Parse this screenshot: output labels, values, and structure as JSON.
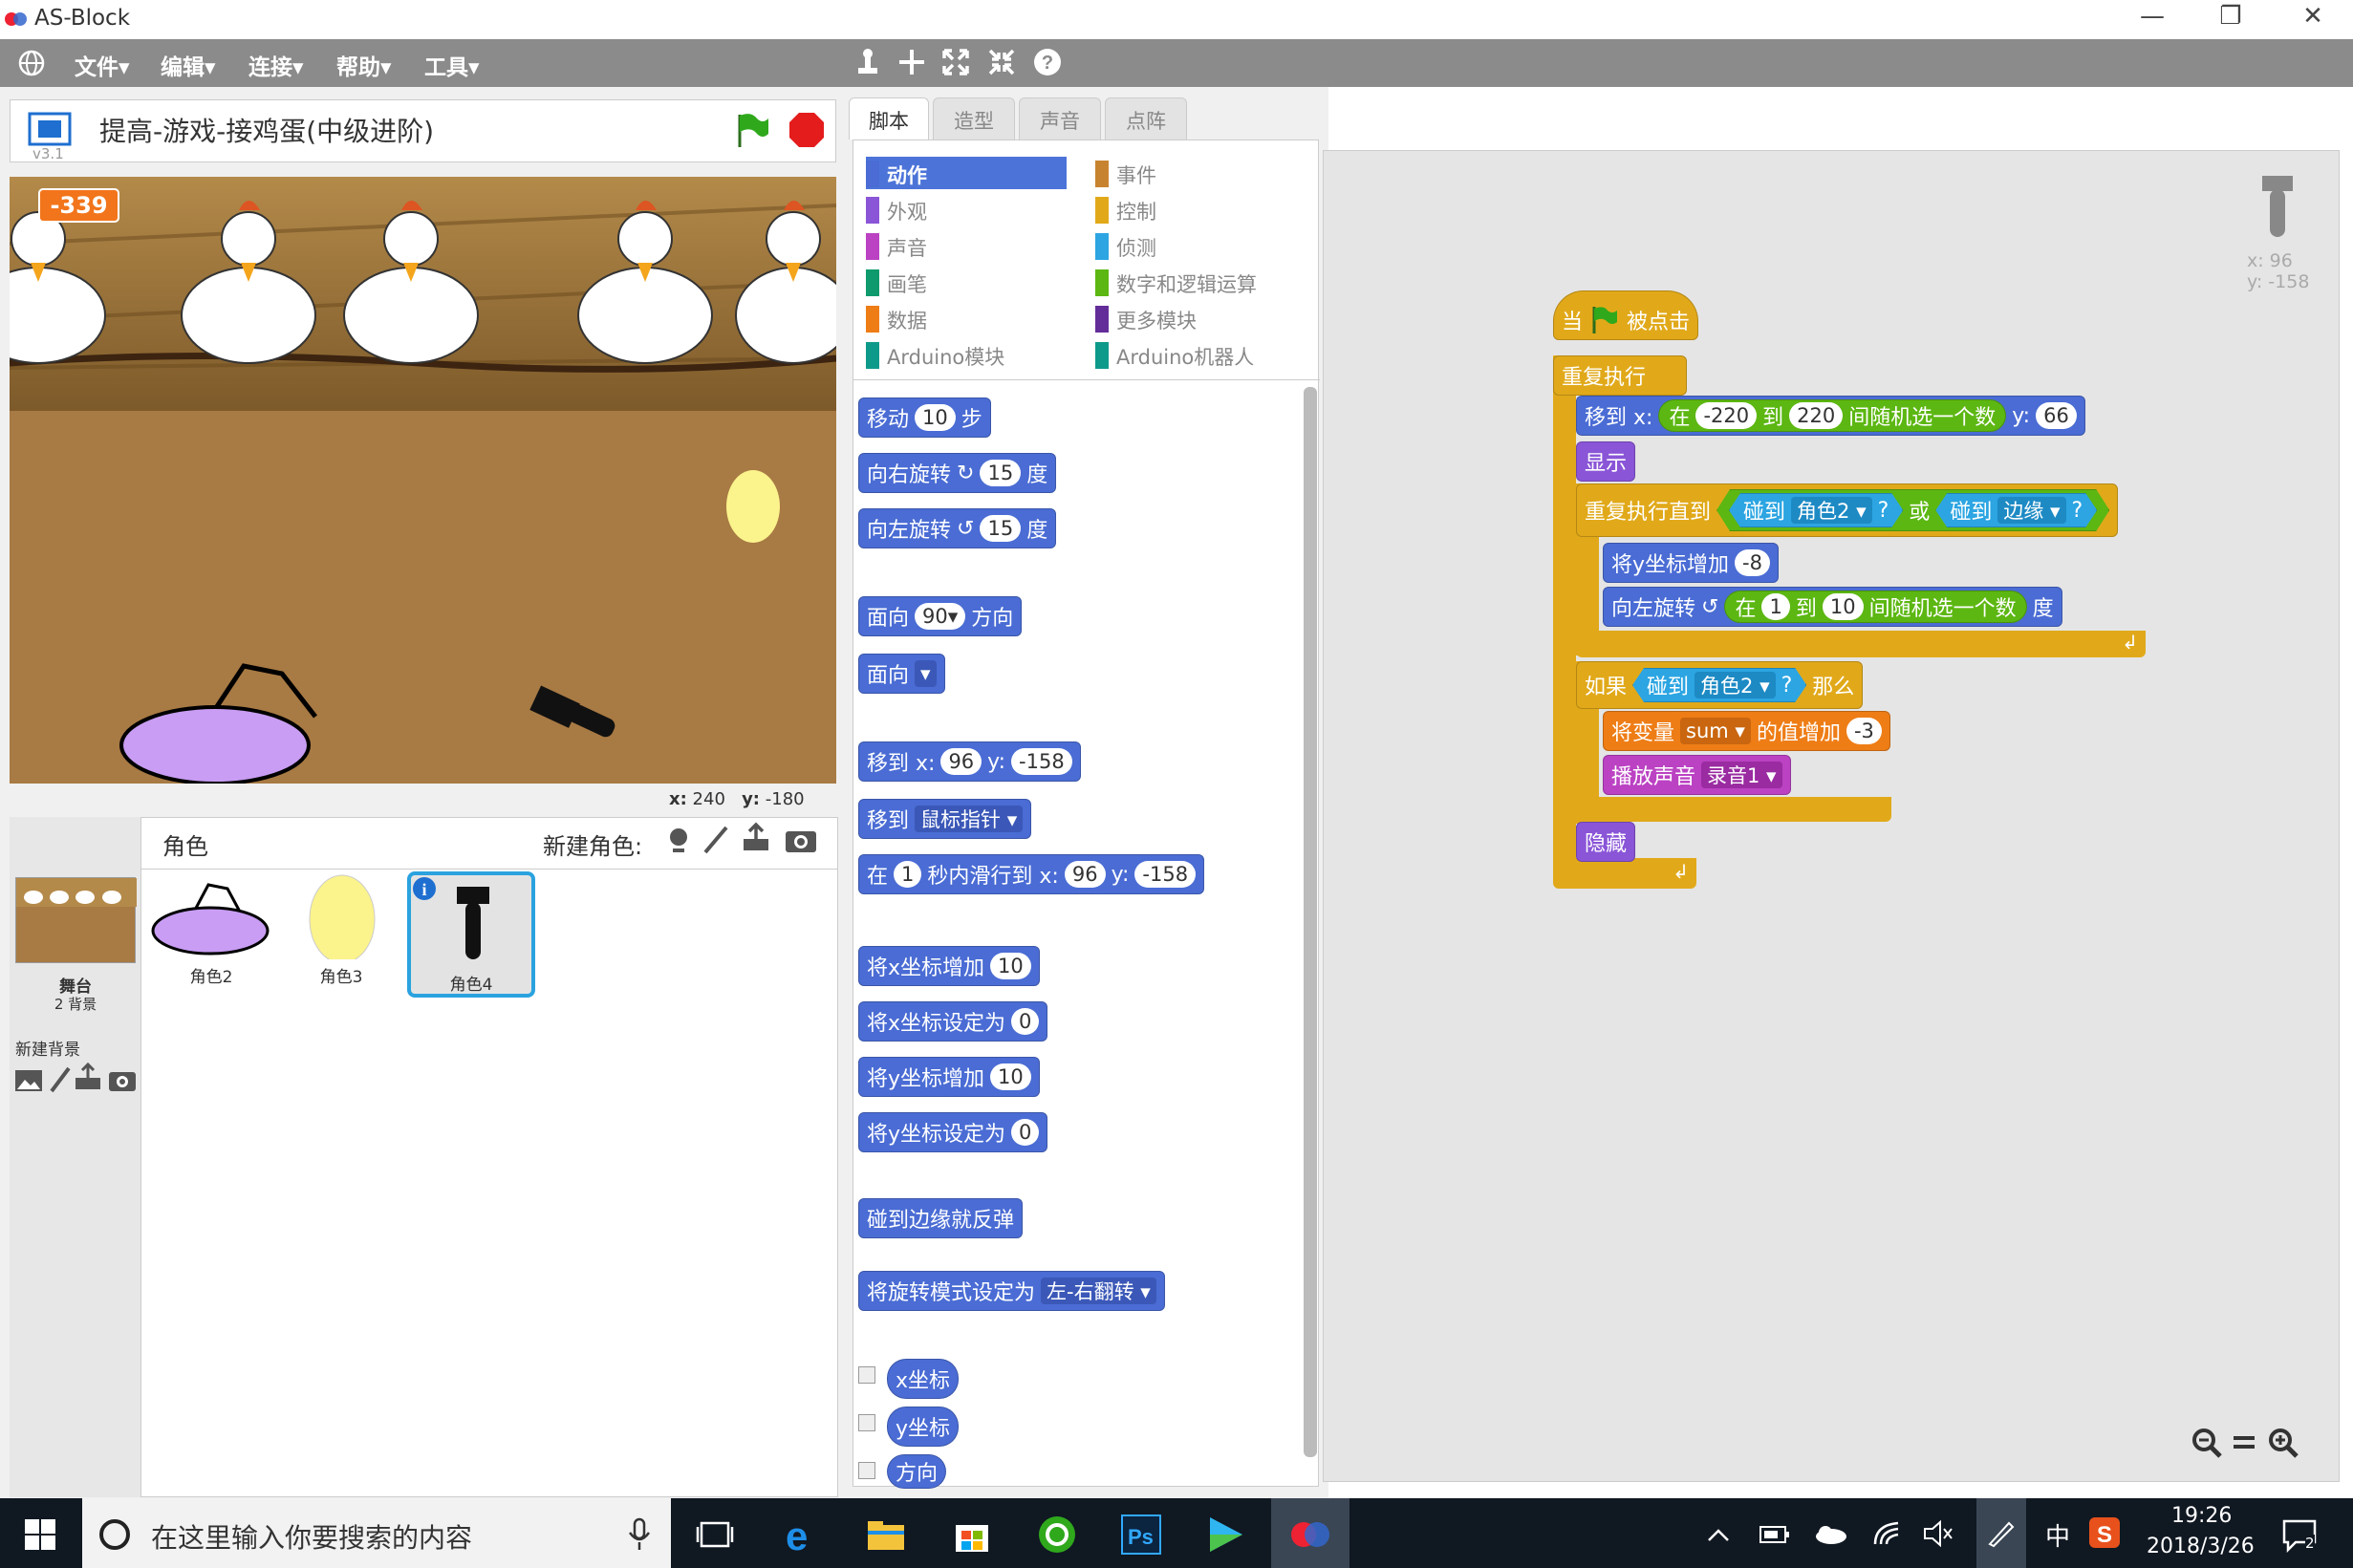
{
  "window": {
    "title": "AS-Block",
    "min": "—",
    "max": "❐",
    "close": "✕"
  },
  "menu": [
    "文件▾",
    "编辑▾",
    "连接▾",
    "帮助▾",
    "工具▾"
  ],
  "toolbar_icons": [
    "stamp-icon",
    "move-icon",
    "grow-icon",
    "shrink-icon",
    "help-icon"
  ],
  "stage": {
    "project_title": "提高-游戏-接鸡蛋(中级进阶)",
    "version": "v3.1",
    "score": "-339",
    "coords_x_label": "x:",
    "coords_x": "240",
    "coords_y_label": "y:",
    "coords_y": "-180"
  },
  "sprites": {
    "header": "角色",
    "new_sprite_label": "新建角色:",
    "stage_label": "舞台",
    "stage_sub": "2 背景",
    "new_backdrop_label": "新建背景",
    "items": [
      "角色2",
      "角色3",
      "角色4"
    ]
  },
  "tabs": [
    "脚本",
    "造型",
    "声音",
    "点阵"
  ],
  "categories_left": [
    {
      "label": "动作",
      "color": "#4a6cd4"
    },
    {
      "label": "外观",
      "color": "#8a55d7"
    },
    {
      "label": "声音",
      "color": "#bb42c3"
    },
    {
      "label": "画笔",
      "color": "#0e9a6c"
    },
    {
      "label": "数据",
      "color": "#ee7d16"
    },
    {
      "label": "Arduino模块",
      "color": "#0e9a8a"
    }
  ],
  "categories_right": [
    {
      "label": "事件",
      "color": "#c88330"
    },
    {
      "label": "控制",
      "color": "#e1a91a"
    },
    {
      "label": "侦测",
      "color": "#2ca5e2"
    },
    {
      "label": "数字和逻辑运算",
      "color": "#5cb712"
    },
    {
      "label": "更多模块",
      "color": "#632d99"
    },
    {
      "label": "Arduino机器人",
      "color": "#0e9a8a"
    }
  ],
  "palette": {
    "move": [
      "移动",
      "10",
      "步"
    ],
    "turn_right": [
      "向右旋转",
      "↻",
      "15",
      "度"
    ],
    "turn_left": [
      "向左旋转",
      "↺",
      "15",
      "度"
    ],
    "point_dir": [
      "面向",
      "90▾",
      "方向"
    ],
    "point_towards": [
      "面向",
      "▾"
    ],
    "goto_xy": [
      "移到 x:",
      "96",
      "y:",
      "-158"
    ],
    "goto": [
      "移到",
      "鼠标指针 ▾"
    ],
    "glide": [
      "在",
      "1",
      "秒内滑行到 x:",
      "96",
      "y:",
      "-158"
    ],
    "change_x": [
      "将x坐标增加",
      "10"
    ],
    "set_x": [
      "将x坐标设定为",
      "0"
    ],
    "change_y": [
      "将y坐标增加",
      "10"
    ],
    "set_y": [
      "将y坐标设定为",
      "0"
    ],
    "bounce": "碰到边缘就反弹",
    "rot_style": [
      "将旋转模式设定为",
      "左-右翻转 ▾"
    ],
    "reporters": [
      "x坐标",
      "y坐标",
      "方向"
    ]
  },
  "script": {
    "hat": [
      "当",
      "被点击"
    ],
    "forever": "重复执行",
    "goto": [
      "移到 x:",
      "在",
      "-220",
      "到",
      "220",
      "间随机选一个数",
      "y:",
      "66"
    ],
    "show": "显示",
    "repeat_until": [
      "重复执行直到",
      "碰到",
      "角色2 ▾",
      "?",
      "或",
      "碰到",
      "边缘 ▾",
      "?"
    ],
    "change_y": [
      "将y坐标增加",
      "-8"
    ],
    "turn": [
      "向左旋转",
      "↺",
      "在",
      "1",
      "到",
      "10",
      "间随机选一个数",
      "度"
    ],
    "if": [
      "如果",
      "碰到",
      "角色2 ▾",
      "?",
      "那么"
    ],
    "change_var": [
      "将变量",
      "sum ▾",
      "的值增加",
      "-3"
    ],
    "play": [
      "播放声音",
      "录音1 ▾"
    ],
    "hide": "隐藏",
    "sprite_x": "x: 96",
    "sprite_y": "y: -158"
  },
  "taskbar": {
    "search": "在这里输入你要搜索的内容",
    "time": "19:26",
    "date": "2018/3/26",
    "ime": "中",
    "notif": "2"
  }
}
